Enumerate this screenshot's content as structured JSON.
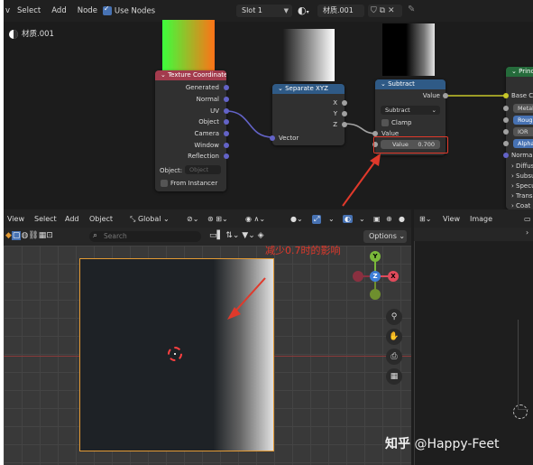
{
  "node_editor": {
    "menu": [
      "v",
      "Select",
      "Add",
      "Node"
    ],
    "use_nodes_label": "Use Nodes",
    "slot": "Slot 1",
    "material": "材质.001",
    "breadcrumb": "材质.001",
    "texture_coordinate": {
      "title": "Texture Coordinate",
      "outputs": [
        "Generated",
        "Normal",
        "UV",
        "Object",
        "Camera",
        "Window",
        "Reflection"
      ],
      "object_label": "Object:",
      "object_placeholder": "Object",
      "from_instancer": "From Instancer"
    },
    "separate_xyz": {
      "title": "Separate XYZ",
      "outputs": [
        "X",
        "Y",
        "Z"
      ],
      "input": "Vector"
    },
    "subtract": {
      "title": "Subtract",
      "output": "Value",
      "operation": "Subtract",
      "clamp": "Clamp",
      "input1": "Value",
      "input2_label": "Value",
      "input2_value": "0.700"
    },
    "principled": {
      "title": "Princip",
      "output": "Base Colo",
      "fields": [
        "Metalli",
        "Rough",
        "IOR",
        "Alpha"
      ],
      "sockets": [
        "Normal",
        "Diffus",
        "Subsu",
        "Specul",
        "Transm",
        "Coat"
      ]
    }
  },
  "viewport": {
    "menu": [
      "View",
      "Select",
      "Add",
      "Object"
    ],
    "transform": "Global",
    "search_placeholder": "Search",
    "options_label": "Options",
    "gizmo": {
      "x": "X",
      "y": "Y",
      "z": "Z"
    }
  },
  "image_editor": {
    "menu": [
      "View",
      "Image"
    ]
  },
  "annotation": "减少0.7时的影响",
  "watermark": {
    "site": "知乎",
    "author": "@Happy-Feet"
  },
  "colors": {
    "annotation_red": "#e0392b",
    "selection_orange": "#e39a34",
    "accent_blue": "#4772b3"
  }
}
